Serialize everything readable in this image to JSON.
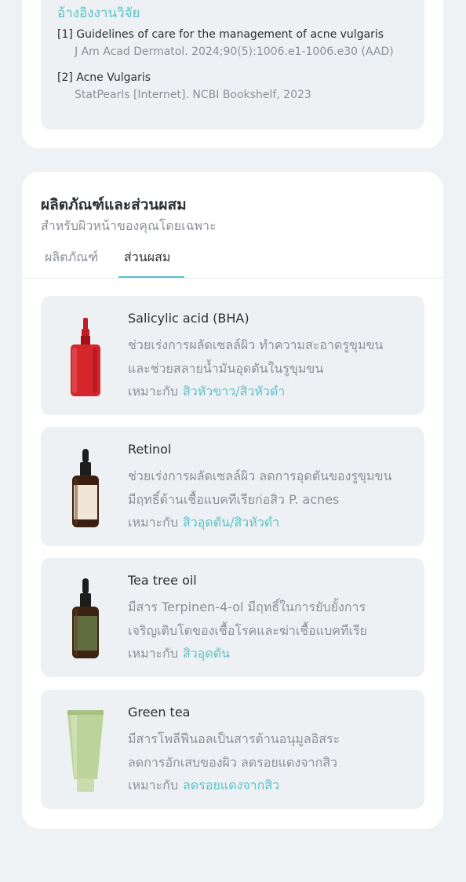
{
  "references": {
    "title": "อ้างอิงงานวิจัย",
    "items": [
      {
        "title": "[1] Guidelines of care for the management of acne vulgaris",
        "source": "J Am Acad Dermatol. 2024;90(5):1006.e1-1006.e30 (AAD)"
      },
      {
        "title": "[2] Acne Vulgaris",
        "source": "StatPearls [Internet]. NCBI Bookshelf, 2023"
      }
    ]
  },
  "products": {
    "title": "ผลิตภัณฑ์และส่วนผสม",
    "subtitle": "สำหรับผิวหน้าของคุณโดยเฉพาะ",
    "tabs": [
      "ผลิตภัณฑ์",
      "ส่วนผสม"
    ],
    "active_tab": "ส่วนผสม",
    "suitable_label": "เหมาะกับ",
    "items": [
      {
        "name": "Salicylic acid (BHA)",
        "desc1": "ช่วยเร่งการผลัดเซลล์ผิว ทำความสะอาดรูขุมขน",
        "desc2": "และช่วยสลายน้ำมันอุดตันในรูขุมขน",
        "suitable": "สิวหัวขาว/สิวหัวดำ",
        "icon": "red-serum-bottle-icon"
      },
      {
        "name": "Retinol",
        "desc1": "ช่วยเร่งการผลัดเซลล์ผิว ลดการอุดตันของรูขุมขน",
        "desc2": "มีฤทธิ์ต้านเชื้อแบคทีเรียก่อสิว P. acnes",
        "suitable": "สิวอุดตัน/สิวหัวดำ",
        "icon": "amber-dropper-bottle-icon"
      },
      {
        "name": "Tea tree oil",
        "desc1": "มีสาร Terpinen-4-ol มีฤทธิ์ในการยับยั้งการ",
        "desc2": "เจริญเติบโตของเชื้อโรคและฆ่าเชื้อแบคทีเรีย",
        "suitable": "สิวอุดตัน",
        "icon": "green-label-dropper-bottle-icon"
      },
      {
        "name": "Green tea",
        "desc1": "มีสารโพลีฟีนอลเป็นสารต้านอนุมูลอิสระ",
        "desc2": "ลดการอักเสบของผิว ลดรอยแดงจากสิว",
        "suitable": "ลดรอยแดงจากสิว",
        "icon": "green-tube-icon"
      }
    ]
  },
  "colors": {
    "accent": "#5bc1c9",
    "background": "#eef2f4",
    "card": "#ffffff",
    "inner": "#eef1f3",
    "muted": "#8b9096"
  }
}
